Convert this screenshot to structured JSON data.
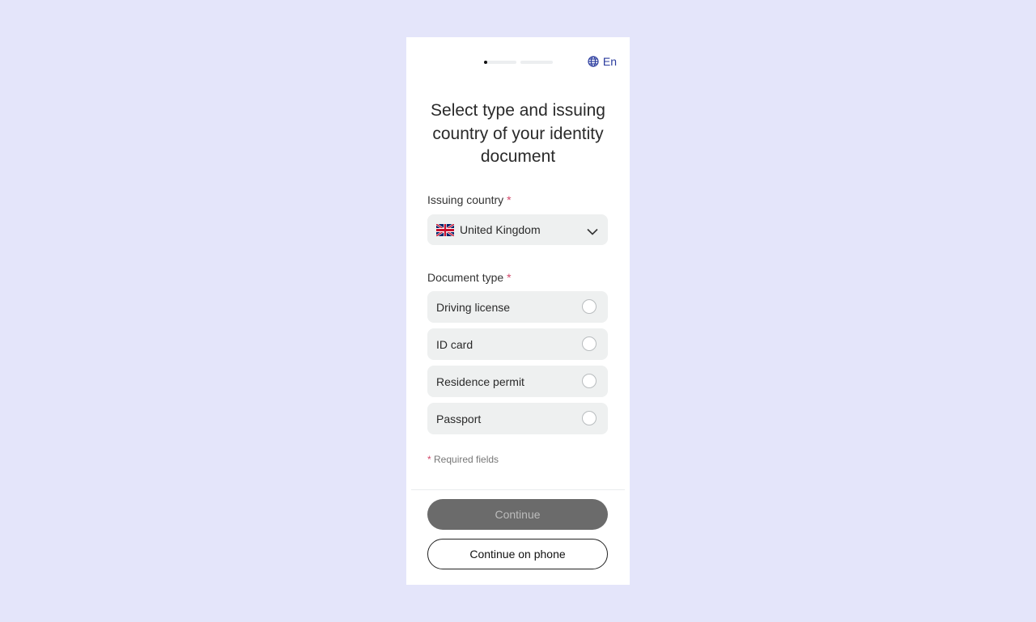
{
  "header": {
    "language": "En",
    "progress_steps": 2,
    "progress_current": 1
  },
  "title": "Select type and issuing country of your identity document",
  "country": {
    "label": "Issuing country",
    "required_mark": "*",
    "value": "United Kingdom",
    "flag_icon": "uk-flag-icon"
  },
  "document": {
    "label": "Document type",
    "required_mark": "*",
    "options": [
      {
        "label": "Driving license",
        "selected": false
      },
      {
        "label": "ID card",
        "selected": false
      },
      {
        "label": "Residence permit",
        "selected": false
      },
      {
        "label": "Passport",
        "selected": false
      }
    ]
  },
  "required_note": {
    "mark": "*",
    "text": " Required fields"
  },
  "buttons": {
    "continue": "Continue",
    "continue_on_phone": "Continue on phone"
  },
  "colors": {
    "background": "#e4e5fa",
    "accent": "#2b3c9e",
    "required": "#d2476a",
    "primary_button_disabled": "#6b6b6b"
  }
}
